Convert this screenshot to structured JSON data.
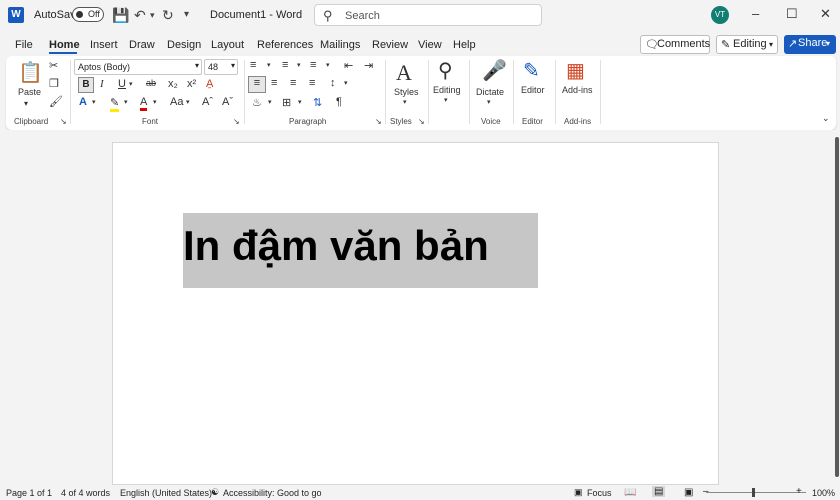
{
  "titlebar": {
    "autosave_label": "AutoSave",
    "autosave_state": "Off",
    "document_title": "Document1 - Word",
    "search_placeholder": "Search",
    "user_initials": "VT",
    "minimize": "–",
    "maximize": "☐",
    "close": "✕"
  },
  "menu": {
    "tabs": [
      "File",
      "Home",
      "Insert",
      "Draw",
      "Design",
      "Layout",
      "References",
      "Mailings",
      "Review",
      "View",
      "Help"
    ],
    "active_tab": "Home",
    "comments_label": "Comments",
    "editing_label": "Editing",
    "share_label": "Share"
  },
  "ribbon": {
    "clipboard": {
      "paste_label": "Paste",
      "group_label": "Clipboard"
    },
    "font": {
      "font_name": "Aptos (Body)",
      "font_size": "48",
      "group_label": "Font"
    },
    "paragraph": {
      "group_label": "Paragraph"
    },
    "styles": {
      "styles_label": "Styles",
      "group_label": "Styles"
    },
    "editing": {
      "label": "Editing"
    },
    "voice": {
      "dictate_label": "Dictate",
      "group_label": "Voice"
    },
    "editor": {
      "editor_label": "Editor",
      "group_label": "Editor"
    },
    "addins": {
      "addins_label": "Add-ins",
      "group_label": "Add-ins"
    }
  },
  "document": {
    "body_text": "In đậm văn bản"
  },
  "statusbar": {
    "page": "Page 1 of 1",
    "words": "4 of 4 words",
    "language": "English (United States)",
    "accessibility": "Accessibility: Good to go",
    "focus": "Focus",
    "zoom": "100%"
  },
  "colors": {
    "accent": "#185abd",
    "selection": "#c6c6c6",
    "avatar": "#127d72"
  }
}
